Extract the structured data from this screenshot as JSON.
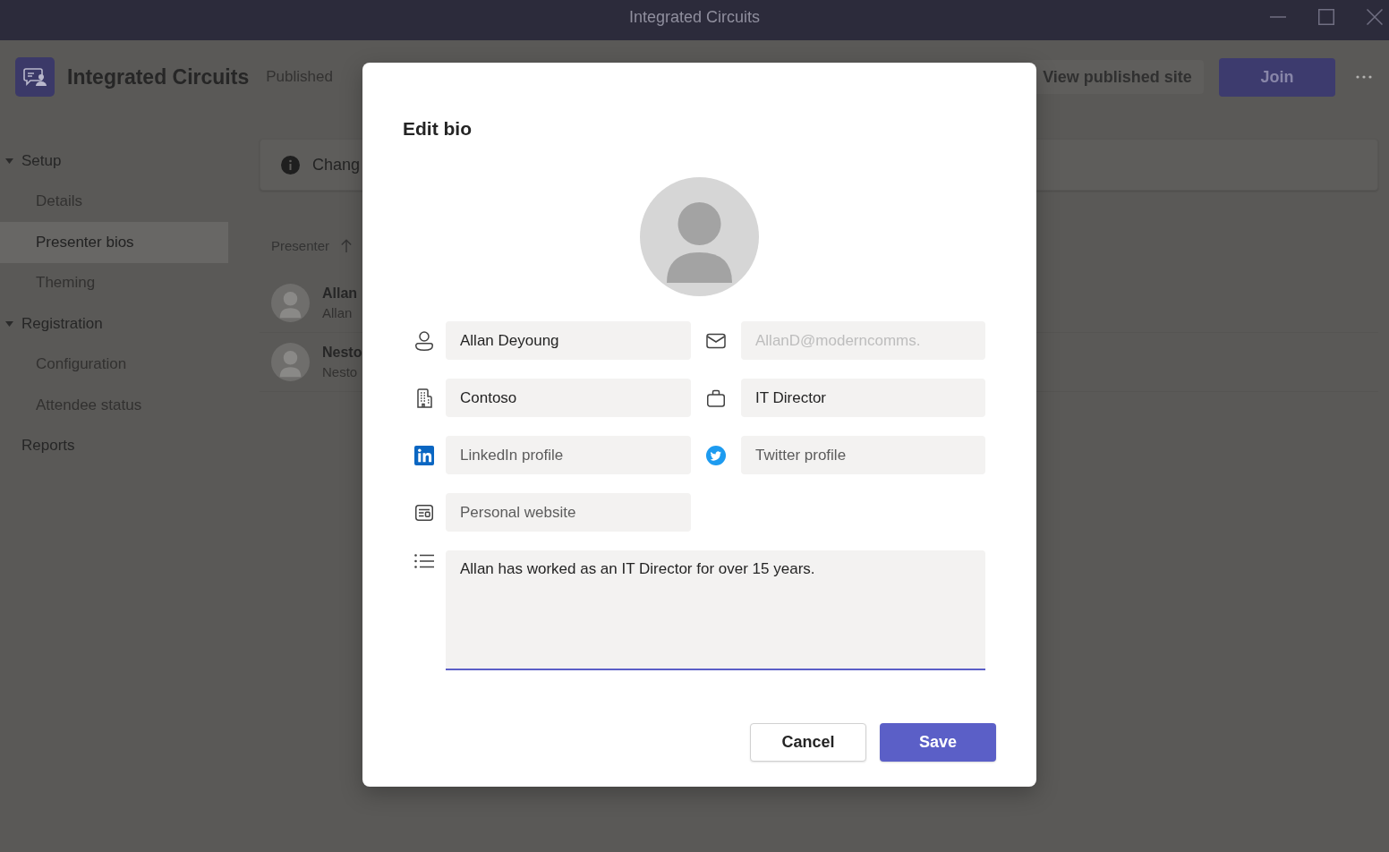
{
  "window": {
    "title": "Integrated Circuits"
  },
  "header": {
    "title": "Integrated Circuits",
    "status": "Published",
    "buttons": [
      {
        "label": "View published site",
        "kind": "secondary"
      },
      {
        "label": "Join",
        "kind": "primary"
      }
    ]
  },
  "sidebar": {
    "items": [
      {
        "label": "Setup",
        "kind": "section",
        "selected": false,
        "expanded": true,
        "children": [
          {
            "label": "Details",
            "selected": false
          },
          {
            "label": "Presenter bios",
            "selected": true
          },
          {
            "label": "Theming",
            "selected": false
          }
        ]
      },
      {
        "label": "Registration",
        "kind": "section",
        "selected": false,
        "expanded": true,
        "children": [
          {
            "label": "Configuration",
            "selected": false
          },
          {
            "label": "Attendee status",
            "selected": false
          }
        ]
      },
      {
        "label": "Reports",
        "kind": "link",
        "selected": false
      }
    ]
  },
  "banner": {
    "text": "Chang"
  },
  "table": {
    "columns": [
      {
        "label": "Presenter",
        "sorted": true
      }
    ],
    "rows": [
      {
        "name": "Allan",
        "email": "Allan"
      },
      {
        "name": "Nesto",
        "email": "Nesto"
      }
    ]
  },
  "dialog": {
    "title": "Edit bio",
    "fields": [
      {
        "kind": "name",
        "value": "Allan Deyoung",
        "disabled": false
      },
      {
        "kind": "email",
        "value": "AllanD@moderncomms.",
        "disabled": true
      },
      {
        "kind": "company",
        "value": "Contoso",
        "disabled": false
      },
      {
        "kind": "job",
        "value": "IT Director",
        "disabled": false
      },
      {
        "kind": "linkedin",
        "placeholder": "LinkedIn profile",
        "disabled": false
      },
      {
        "kind": "twitter",
        "placeholder": "Twitter profile",
        "disabled": false
      },
      {
        "kind": "website",
        "placeholder": "Personal website",
        "disabled": false
      }
    ],
    "bio": {
      "value": "Allan has worked as an IT Director for over 15 years.",
      "focused": true
    },
    "buttons": [
      {
        "label": "Cancel",
        "kind": "secondary"
      },
      {
        "label": "Save",
        "kind": "primary"
      }
    ]
  }
}
